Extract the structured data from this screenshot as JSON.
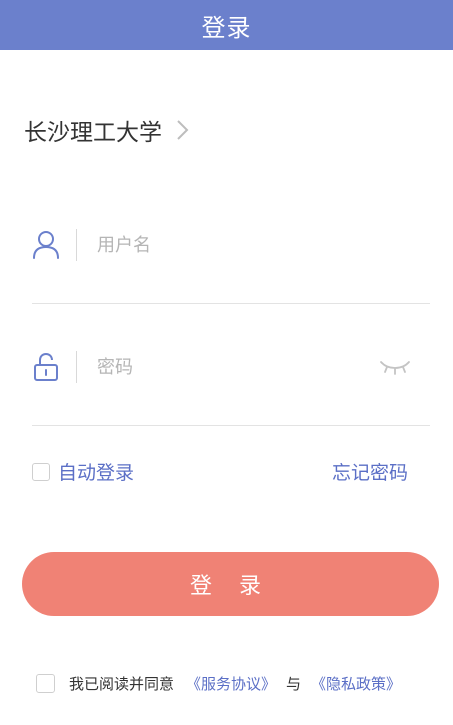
{
  "header": {
    "title": "登录"
  },
  "school": {
    "name": "长沙理工大学"
  },
  "form": {
    "username_placeholder": "用户名",
    "password_placeholder": "密码",
    "auto_login_label": "自动登录",
    "forgot_password_label": "忘记密码",
    "login_button_label": "登 录"
  },
  "agreement": {
    "prefix": "我已阅读并同意",
    "service_link": "《服务协议》",
    "joiner": "与",
    "privacy_link": "《隐私政策》"
  },
  "colors": {
    "header_bg": "#6b80cc",
    "accent": "#5b6fc6",
    "login_button": "#f08275"
  },
  "icons": {
    "user": "user-icon",
    "lock": "lock-icon",
    "eye": "eye-closed-icon",
    "chevron": "chevron-right-icon"
  }
}
